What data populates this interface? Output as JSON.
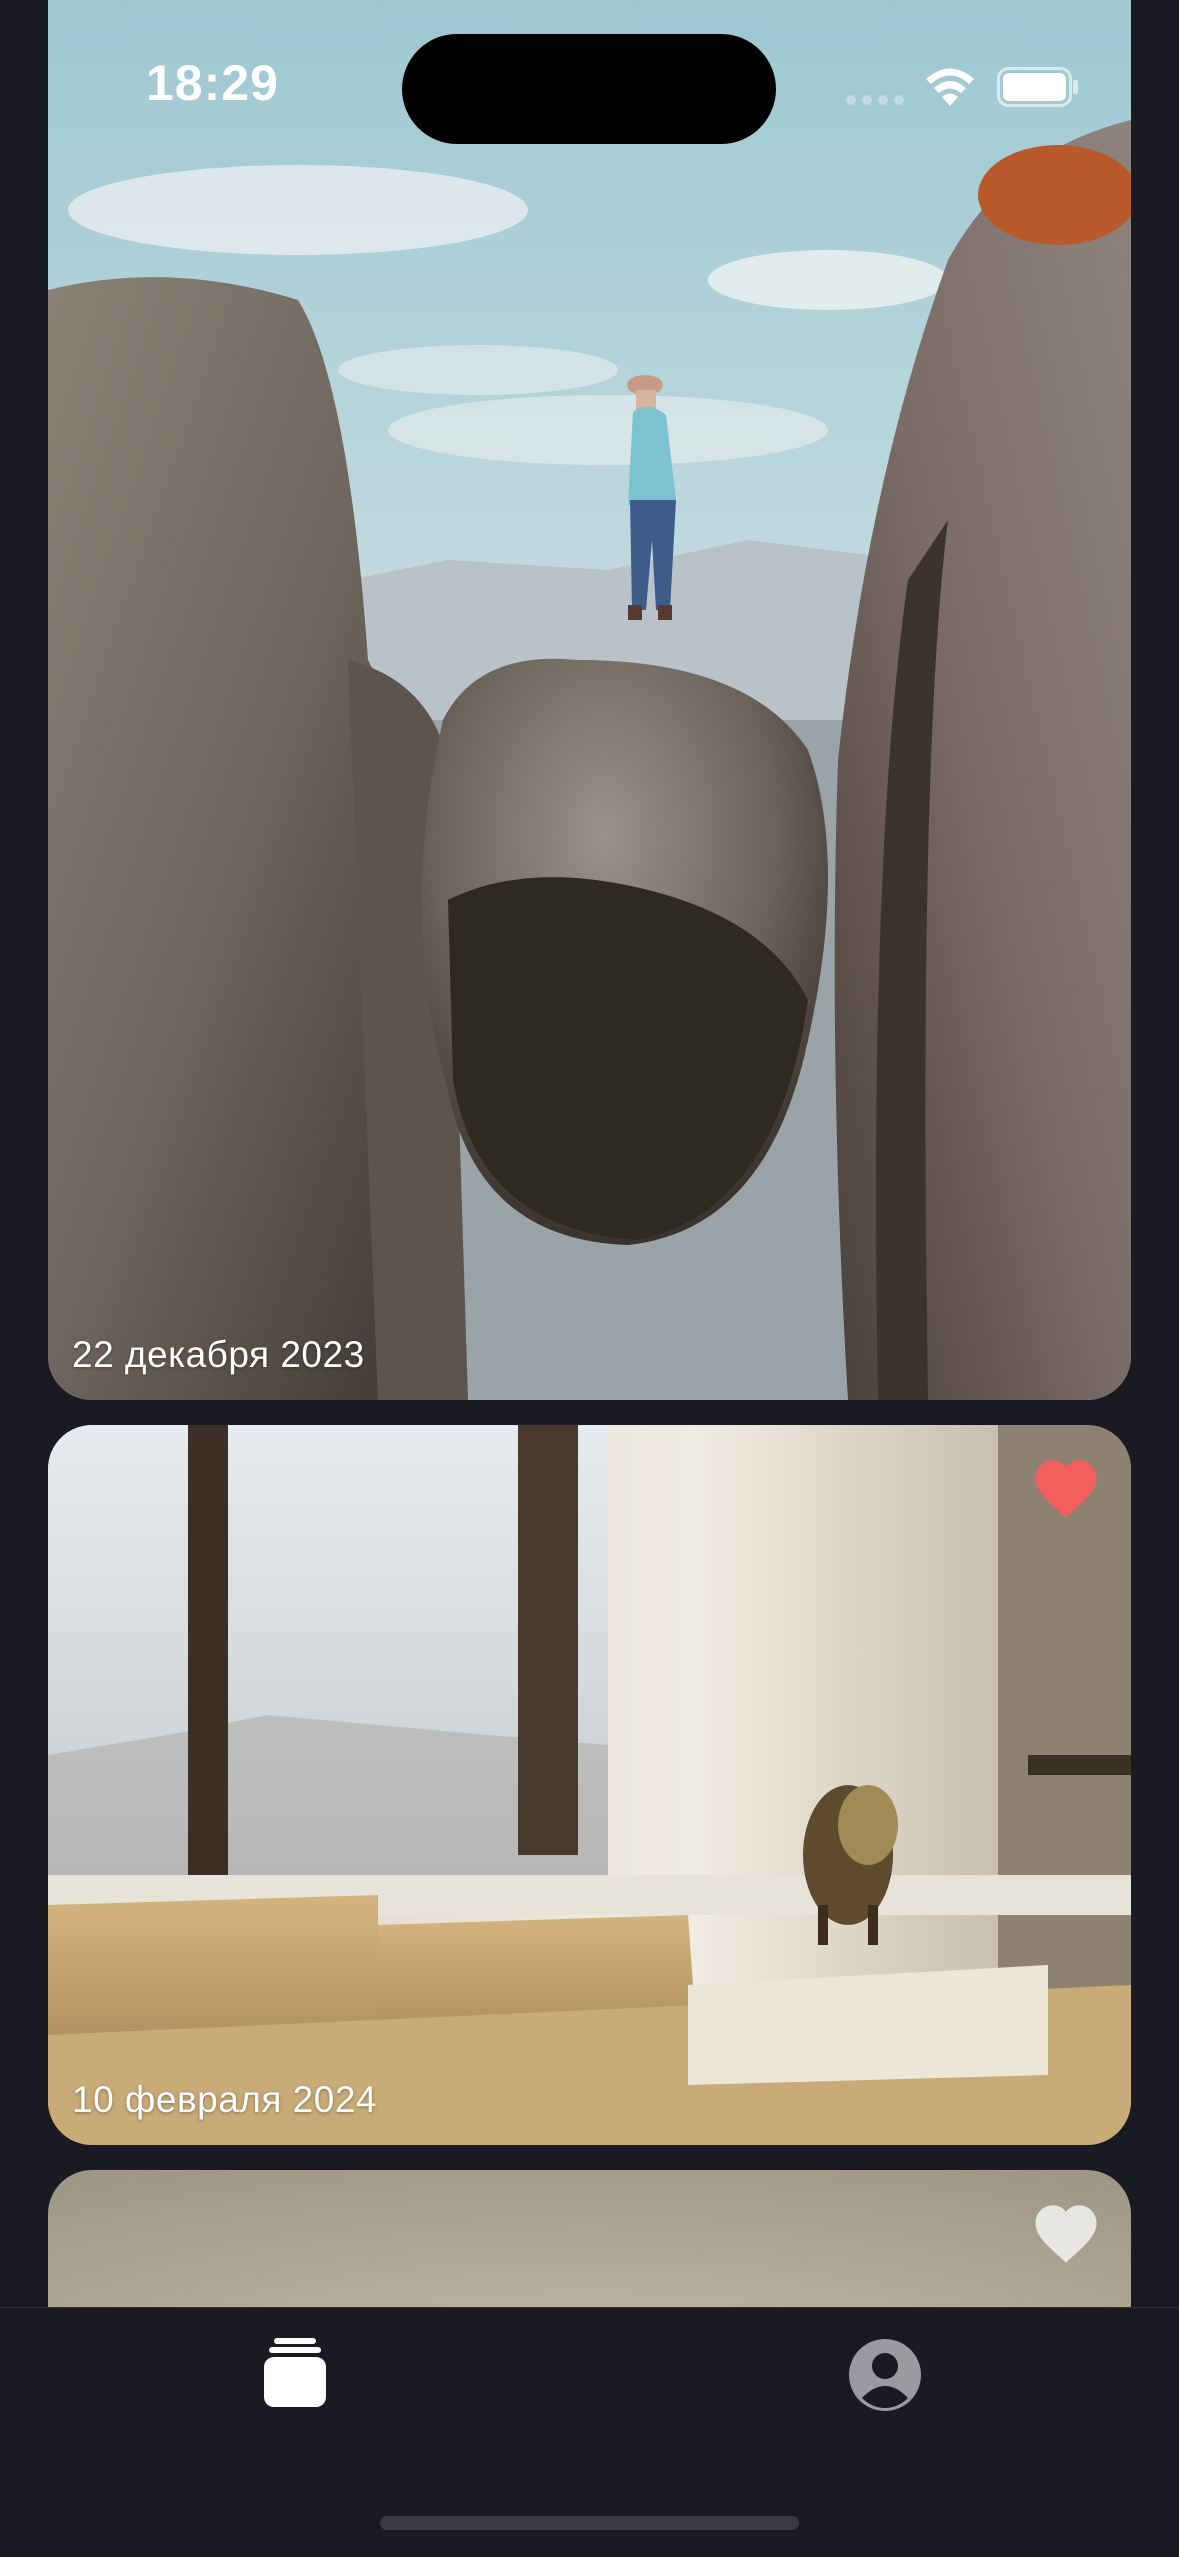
{
  "status_bar": {
    "time": "18:29",
    "icons": [
      "cellular-signal-icon",
      "wifi-icon",
      "battery-icon"
    ]
  },
  "feed": {
    "cards": [
      {
        "date": "22 декабря 2023",
        "liked": null,
        "image": "person-on-boulder-between-cliffs"
      },
      {
        "date": "10 февраля 2024",
        "liked": true,
        "image": "sunlit-room-with-sofa-and-window"
      },
      {
        "date": "",
        "liked": false,
        "image": "beige-wall-partial"
      }
    ]
  },
  "tab_bar": {
    "tabs": [
      {
        "icon": "photo-stack-icon",
        "active": true
      },
      {
        "icon": "profile-icon",
        "active": false
      }
    ]
  },
  "colors": {
    "background": "#1a1b22",
    "like_active": "#f2605e",
    "like_inactive": "#ffffff",
    "tab_active": "#ffffff",
    "tab_inactive": "#9a9aa0"
  }
}
